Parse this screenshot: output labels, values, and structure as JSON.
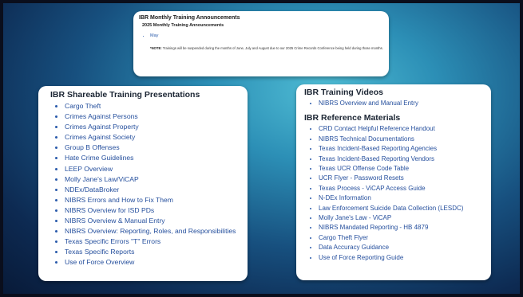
{
  "announcements": {
    "title": "IBR Monthly Training Announcements",
    "subtitle": "2025 Monthly Training Announcements",
    "items": [
      "May"
    ],
    "note_label": "*NOTE:",
    "note_text": " Trainings will be suspended during the months of June, July and August due to our 2025 Crime Records Conference being held during those months."
  },
  "presentations": {
    "title": "IBR Shareable Training Presentations",
    "items": [
      "Cargo Theft",
      "Crimes Against Persons",
      "Crimes Against Property",
      "Crimes Against Society",
      "Group B Offenses",
      "Hate Crime Guidelines",
      "LEEP Overview",
      "Molly Jane's Law/ViCAP",
      "NDEx/DataBroker",
      "NIBRS Errors and How to Fix Them",
      "NIBRS Overview for ISD PDs",
      "NIBRS Overview & Manual Entry",
      "NIBRS Overview: Reporting, Roles, and Responsibilities",
      "Texas Specific Errors \"T\" Errors",
      "Texas Specific Reports",
      "Use of Force Overview"
    ]
  },
  "videos": {
    "title": "IBR Training Videos",
    "items": [
      "NIBRS Overview and Manual Entry"
    ]
  },
  "references": {
    "title": "IBR Reference Materials",
    "items": [
      "CRD Contact Helpful Reference Handout",
      "NIBRS Technical Documentations",
      "Texas Incident-Based Reporting Agencies",
      "Texas Incident-Based Reporting Vendors",
      "Texas UCR Offense Code Table",
      "UCR Flyer - Password Resets",
      "Texas Process - ViCAP Access Guide",
      "N-DEx Information",
      "Law Enforcement Suicide Data Collection (LESDC)",
      "Molly Jane's Law - ViCAP",
      "NIBRS Mandated Reporting - HB 4879",
      "Cargo Theft Flyer",
      "Data Accuracy Guidance",
      "Use of Force Reporting Guide"
    ]
  },
  "colors": {
    "link": "#254f9d",
    "heading": "#1b2533",
    "background_light": "#4fbcd4",
    "background_dark": "#0d2a52"
  }
}
